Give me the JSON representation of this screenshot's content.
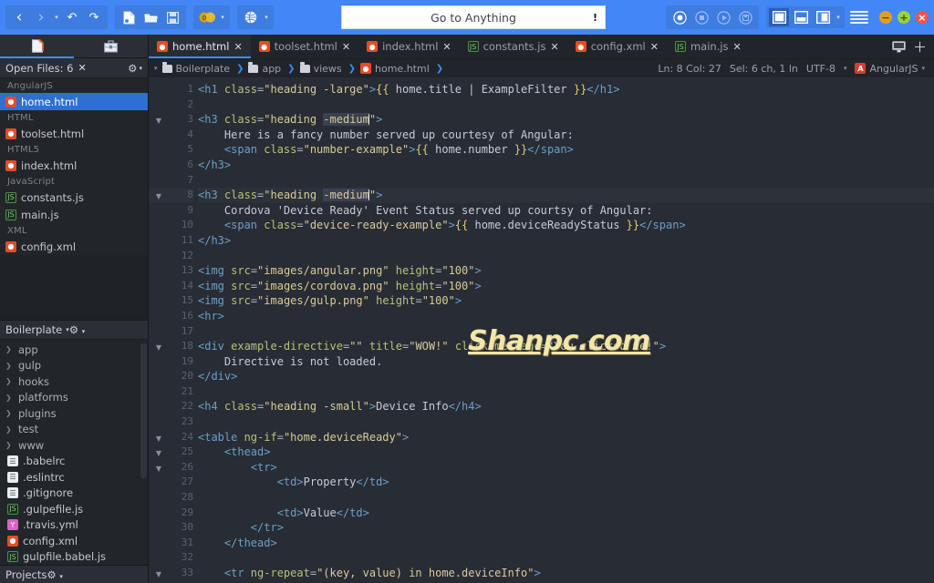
{
  "toolbar": {
    "nav": [
      {
        "name": "back-button",
        "glyph": "‹"
      },
      {
        "name": "forward-button",
        "glyph": "›"
      },
      {
        "name": "nav-dropdown-caret",
        "glyph": "▾"
      },
      {
        "name": "undo-button",
        "glyph": "↶"
      },
      {
        "name": "redo-button",
        "glyph": "↷"
      }
    ],
    "file_actions": [
      {
        "name": "new-file-button",
        "label": "New File"
      },
      {
        "name": "open-folder-button",
        "label": "Open Folder"
      },
      {
        "name": "save-button",
        "label": "Save"
      }
    ],
    "debug": {
      "name": "breakpoints-button",
      "label": "Breakpoints",
      "count": "0",
      "caret": "▾"
    },
    "preview": {
      "name": "live-preview-button",
      "label": "Live Preview",
      "caret": "▾"
    },
    "search": {
      "placeholder": "Go to Anything",
      "value": "Go to Anything",
      "warn_icon": "!"
    },
    "record_group": [
      {
        "name": "record-button",
        "label": "Record"
      },
      {
        "name": "stop-button",
        "label": "Stop"
      },
      {
        "name": "play-button",
        "label": "Play"
      },
      {
        "name": "save-session-button",
        "label": "Save Session"
      }
    ],
    "pane_layouts": [
      {
        "name": "layout-single-pane-button",
        "label": "Single Pane",
        "active": true
      },
      {
        "name": "layout-horizontal-split-button",
        "label": "Horizontal Split",
        "active": false
      },
      {
        "name": "layout-vertical-split-button",
        "label": "Vertical Split",
        "active": false
      }
    ],
    "pane_caret": "▾",
    "menu_button": {
      "name": "main-menu-button",
      "label": "Menu"
    },
    "window_controls": [
      {
        "name": "minimize-button",
        "glyph": "—",
        "color": "#e0a11a"
      },
      {
        "name": "maximize-button",
        "glyph": "+",
        "color": "#9fd13a"
      },
      {
        "name": "close-button",
        "glyph": "×",
        "color": "#f0554a"
      }
    ]
  },
  "sidebar": {
    "tabs": [
      {
        "name": "sidebar-tab-files",
        "label": "Files",
        "active": true
      },
      {
        "name": "sidebar-tab-toolbox",
        "label": "Toolbox",
        "active": false
      }
    ],
    "open_files": {
      "title": "Open Files: 6",
      "close_label": "✕",
      "gear": "⚙",
      "caret": "▾",
      "groups": [
        {
          "label": "AngularJS",
          "files": [
            {
              "name": "home.html",
              "icon": "html",
              "selected": true
            }
          ]
        },
        {
          "label": "HTML",
          "files": [
            {
              "name": "toolset.html",
              "icon": "html",
              "selected": false
            }
          ]
        },
        {
          "label": "HTML5",
          "files": [
            {
              "name": "index.html",
              "icon": "html",
              "selected": false
            }
          ]
        },
        {
          "label": "JavaScript",
          "files": [
            {
              "name": "constants.js",
              "icon": "js",
              "selected": false
            },
            {
              "name": "main.js",
              "icon": "js",
              "selected": false
            }
          ]
        },
        {
          "label": "XML",
          "files": [
            {
              "name": "config.xml",
              "icon": "xml",
              "selected": false
            }
          ]
        }
      ]
    },
    "project": {
      "title": "Boilerplate",
      "caret": "▾",
      "gear": "⚙",
      "items": [
        {
          "label": "app",
          "type": "folder"
        },
        {
          "label": "gulp",
          "type": "folder"
        },
        {
          "label": "hooks",
          "type": "folder"
        },
        {
          "label": "platforms",
          "type": "folder"
        },
        {
          "label": "plugins",
          "type": "folder"
        },
        {
          "label": "test",
          "type": "folder"
        },
        {
          "label": "www",
          "type": "folder"
        },
        {
          "label": ".babelrc",
          "type": "file",
          "icon": "txt"
        },
        {
          "label": ".eslintrc",
          "type": "file",
          "icon": "txt"
        },
        {
          "label": ".gitignore",
          "type": "file",
          "icon": "txt"
        },
        {
          "label": ".gulpefile.js",
          "type": "file",
          "icon": "js"
        },
        {
          "label": ".travis.yml",
          "type": "file",
          "icon": "yml"
        },
        {
          "label": "config.xml",
          "type": "file",
          "icon": "xml"
        },
        {
          "label": "gulpfile.babel.js",
          "type": "file",
          "icon": "js"
        }
      ]
    },
    "projects_title": "Projects",
    "projects_gear": "⚙"
  },
  "editor_tabs": {
    "tabs": [
      {
        "label": "home.html",
        "icon": "html",
        "active": true,
        "close": "✕"
      },
      {
        "label": "toolset.html",
        "icon": "html",
        "active": false,
        "close": "✕"
      },
      {
        "label": "index.html",
        "icon": "html",
        "active": false,
        "close": "✕"
      },
      {
        "label": "constants.js",
        "icon": "js",
        "active": false,
        "close": "✕"
      },
      {
        "label": "config.xml",
        "icon": "xml",
        "active": false,
        "close": "✕"
      },
      {
        "label": "main.js",
        "icon": "js",
        "active": false,
        "close": "✕"
      }
    ],
    "split_button": {
      "name": "split-view-button",
      "label": "Split View"
    },
    "add_button": {
      "name": "new-tab-button",
      "label": "＋"
    }
  },
  "breadcrumb": {
    "caret": "▾",
    "items": [
      {
        "label": "Boilerplate",
        "type": "folder"
      },
      {
        "label": "app",
        "type": "folder"
      },
      {
        "label": "views",
        "type": "folder"
      },
      {
        "label": "home.html",
        "type": "html"
      }
    ],
    "chevron": "❯"
  },
  "status": {
    "cursor": "Ln: 8 Col: 27",
    "selection": "Sel: 6 ch, 1 ln",
    "encoding": "UTF-8",
    "encoding_caret": "▾",
    "language": "AngularJS",
    "language_caret": "▾",
    "language_badge": "A"
  },
  "watermark": "Shanpc.com",
  "code": {
    "first_line": 1,
    "lines": [
      {
        "n": 1,
        "fold": "",
        "highlight": false,
        "tokens": [
          {
            "t": "<h1 ",
            "c": "tag"
          },
          {
            "t": "class",
            "c": "attr"
          },
          {
            "t": "=",
            "c": "plain"
          },
          {
            "t": "\"heading -large\"",
            "c": "str"
          },
          {
            "t": ">",
            "c": "tag"
          },
          {
            "t": "{{",
            "c": "brace"
          },
          {
            "t": " home.title | ExampleFilter ",
            "c": "txt"
          },
          {
            "t": "}}",
            "c": "brace"
          },
          {
            "t": "</h1>",
            "c": "tag"
          }
        ]
      },
      {
        "n": 2,
        "fold": "",
        "highlight": false,
        "tokens": []
      },
      {
        "n": 3,
        "fold": "▼",
        "highlight": false,
        "tokens": [
          {
            "t": "<h3 ",
            "c": "tag"
          },
          {
            "t": "class",
            "c": "attr"
          },
          {
            "t": "=",
            "c": "plain"
          },
          {
            "t": "\"heading ",
            "c": "str"
          },
          {
            "t": "-medium",
            "c": "str",
            "sel": true
          },
          {
            "t": "|",
            "c": "cursor"
          },
          {
            "t": "\"",
            "c": "str"
          },
          {
            "t": ">",
            "c": "tag"
          }
        ]
      },
      {
        "n": 4,
        "fold": "",
        "highlight": false,
        "tokens": [
          {
            "t": "    Here is a fancy number served up courtesy of Angular:",
            "c": "txt"
          }
        ]
      },
      {
        "n": 5,
        "fold": "",
        "highlight": false,
        "tokens": [
          {
            "t": "    <span ",
            "c": "tag"
          },
          {
            "t": "class",
            "c": "attr"
          },
          {
            "t": "=",
            "c": "plain"
          },
          {
            "t": "\"number-example\"",
            "c": "str"
          },
          {
            "t": ">",
            "c": "tag"
          },
          {
            "t": "{{",
            "c": "brace"
          },
          {
            "t": " home.number ",
            "c": "txt"
          },
          {
            "t": "}}",
            "c": "brace"
          },
          {
            "t": "</span>",
            "c": "tag"
          }
        ]
      },
      {
        "n": 6,
        "fold": "",
        "highlight": false,
        "tokens": [
          {
            "t": "</h3>",
            "c": "tag"
          }
        ]
      },
      {
        "n": 7,
        "fold": "",
        "highlight": false,
        "tokens": []
      },
      {
        "n": 8,
        "fold": "▼",
        "highlight": true,
        "tokens": [
          {
            "t": "<h3 ",
            "c": "tag"
          },
          {
            "t": "class",
            "c": "attr"
          },
          {
            "t": "=",
            "c": "plain"
          },
          {
            "t": "\"heading ",
            "c": "str"
          },
          {
            "t": "-medium",
            "c": "str",
            "sel": true
          },
          {
            "t": "|",
            "c": "cursor"
          },
          {
            "t": "\"",
            "c": "str"
          },
          {
            "t": ">",
            "c": "tag"
          }
        ]
      },
      {
        "n": 9,
        "fold": "",
        "highlight": false,
        "tokens": [
          {
            "t": "    Cordova 'Device Ready' Event Status served up courtsy of Angular:",
            "c": "txt"
          }
        ]
      },
      {
        "n": 10,
        "fold": "",
        "highlight": false,
        "tokens": [
          {
            "t": "    <span ",
            "c": "tag"
          },
          {
            "t": "class",
            "c": "attr"
          },
          {
            "t": "=",
            "c": "plain"
          },
          {
            "t": "\"device-ready-example\"",
            "c": "str"
          },
          {
            "t": ">",
            "c": "tag"
          },
          {
            "t": "{{",
            "c": "brace"
          },
          {
            "t": " home.deviceReadyStatus ",
            "c": "txt"
          },
          {
            "t": "}}",
            "c": "brace"
          },
          {
            "t": "</span>",
            "c": "tag"
          }
        ]
      },
      {
        "n": 11,
        "fold": "",
        "highlight": false,
        "tokens": [
          {
            "t": "</h3>",
            "c": "tag"
          }
        ]
      },
      {
        "n": 12,
        "fold": "",
        "highlight": false,
        "tokens": []
      },
      {
        "n": 13,
        "fold": "",
        "highlight": false,
        "tokens": [
          {
            "t": "<img ",
            "c": "tag"
          },
          {
            "t": "src",
            "c": "attr"
          },
          {
            "t": "=",
            "c": "plain"
          },
          {
            "t": "\"images/angular.png\"",
            "c": "str"
          },
          {
            "t": " height",
            "c": "attr"
          },
          {
            "t": "=",
            "c": "plain"
          },
          {
            "t": "\"100\"",
            "c": "str"
          },
          {
            "t": ">",
            "c": "tag"
          }
        ]
      },
      {
        "n": 14,
        "fold": "",
        "highlight": false,
        "tokens": [
          {
            "t": "<img ",
            "c": "tag"
          },
          {
            "t": "src",
            "c": "attr"
          },
          {
            "t": "=",
            "c": "plain"
          },
          {
            "t": "\"images/cordova.png\"",
            "c": "str"
          },
          {
            "t": " height",
            "c": "attr"
          },
          {
            "t": "=",
            "c": "plain"
          },
          {
            "t": "\"100\"",
            "c": "str"
          },
          {
            "t": ">",
            "c": "tag"
          }
        ]
      },
      {
        "n": 15,
        "fold": "",
        "highlight": false,
        "tokens": [
          {
            "t": "<img ",
            "c": "tag"
          },
          {
            "t": "src",
            "c": "attr"
          },
          {
            "t": "=",
            "c": "plain"
          },
          {
            "t": "\"images/gulp.png\"",
            "c": "str"
          },
          {
            "t": " height",
            "c": "attr"
          },
          {
            "t": "=",
            "c": "plain"
          },
          {
            "t": "\"100\"",
            "c": "str"
          },
          {
            "t": ">",
            "c": "tag"
          }
        ]
      },
      {
        "n": 16,
        "fold": "",
        "highlight": false,
        "tokens": [
          {
            "t": "<hr>",
            "c": "tag"
          }
        ]
      },
      {
        "n": 17,
        "fold": "",
        "highlight": false,
        "tokens": []
      },
      {
        "n": 18,
        "fold": "▼",
        "highlight": false,
        "tokens": [
          {
            "t": "<div ",
            "c": "tag"
          },
          {
            "t": "example-directive",
            "c": "attr"
          },
          {
            "t": "=",
            "c": "plain"
          },
          {
            "t": "\"\"",
            "c": "str"
          },
          {
            "t": " title",
            "c": "attr"
          },
          {
            "t": "=",
            "c": "plain"
          },
          {
            "t": "\"WOW!\"",
            "c": "str"
          },
          {
            "t": " click-message",
            "c": "attr"
          },
          {
            "t": "=",
            "c": "plain"
          },
          {
            "t": "\"You clicked me!\"",
            "c": "str"
          },
          {
            "t": ">",
            "c": "tag"
          }
        ]
      },
      {
        "n": 19,
        "fold": "",
        "highlight": false,
        "tokens": [
          {
            "t": "    Directive is not loaded.",
            "c": "txt"
          }
        ]
      },
      {
        "n": 20,
        "fold": "",
        "highlight": false,
        "tokens": [
          {
            "t": "</div>",
            "c": "tag"
          }
        ]
      },
      {
        "n": 21,
        "fold": "",
        "highlight": false,
        "tokens": []
      },
      {
        "n": 22,
        "fold": "",
        "highlight": false,
        "tokens": [
          {
            "t": "<h4 ",
            "c": "tag"
          },
          {
            "t": "class",
            "c": "attr"
          },
          {
            "t": "=",
            "c": "plain"
          },
          {
            "t": "\"heading -small\"",
            "c": "str"
          },
          {
            "t": ">",
            "c": "tag"
          },
          {
            "t": "Device Info",
            "c": "txt"
          },
          {
            "t": "</h4>",
            "c": "tag"
          }
        ]
      },
      {
        "n": 23,
        "fold": "",
        "highlight": false,
        "tokens": []
      },
      {
        "n": 24,
        "fold": "▼",
        "highlight": false,
        "tokens": [
          {
            "t": "<table ",
            "c": "tag"
          },
          {
            "t": "ng-if",
            "c": "attr"
          },
          {
            "t": "=",
            "c": "plain"
          },
          {
            "t": "\"home.deviceReady\"",
            "c": "str"
          },
          {
            "t": ">",
            "c": "tag"
          }
        ]
      },
      {
        "n": 25,
        "fold": "▼",
        "highlight": false,
        "tokens": [
          {
            "t": "    <thead>",
            "c": "tag"
          }
        ]
      },
      {
        "n": 26,
        "fold": "▼",
        "highlight": false,
        "tokens": [
          {
            "t": "        <tr>",
            "c": "tag"
          }
        ]
      },
      {
        "n": 27,
        "fold": "",
        "highlight": false,
        "tokens": [
          {
            "t": "            <td>",
            "c": "tag"
          },
          {
            "t": "Property",
            "c": "txt"
          },
          {
            "t": "</td>",
            "c": "tag"
          }
        ]
      },
      {
        "n": 28,
        "fold": "",
        "highlight": false,
        "tokens": []
      },
      {
        "n": 29,
        "fold": "",
        "highlight": false,
        "tokens": [
          {
            "t": "            <td>",
            "c": "tag"
          },
          {
            "t": "Value",
            "c": "txt"
          },
          {
            "t": "</td>",
            "c": "tag"
          }
        ]
      },
      {
        "n": 30,
        "fold": "",
        "highlight": false,
        "tokens": [
          {
            "t": "        </tr>",
            "c": "tag"
          }
        ]
      },
      {
        "n": 31,
        "fold": "",
        "highlight": false,
        "tokens": [
          {
            "t": "    </thead>",
            "c": "tag"
          }
        ]
      },
      {
        "n": 32,
        "fold": "",
        "highlight": false,
        "tokens": []
      },
      {
        "n": 33,
        "fold": "▼",
        "highlight": false,
        "tokens": [
          {
            "t": "    <tr ",
            "c": "tag"
          },
          {
            "t": "ng-repeat",
            "c": "attr"
          },
          {
            "t": "=",
            "c": "plain"
          },
          {
            "t": "\"(key, value) in home.deviceInfo\"",
            "c": "str"
          },
          {
            "t": ">",
            "c": "tag"
          }
        ]
      }
    ]
  }
}
